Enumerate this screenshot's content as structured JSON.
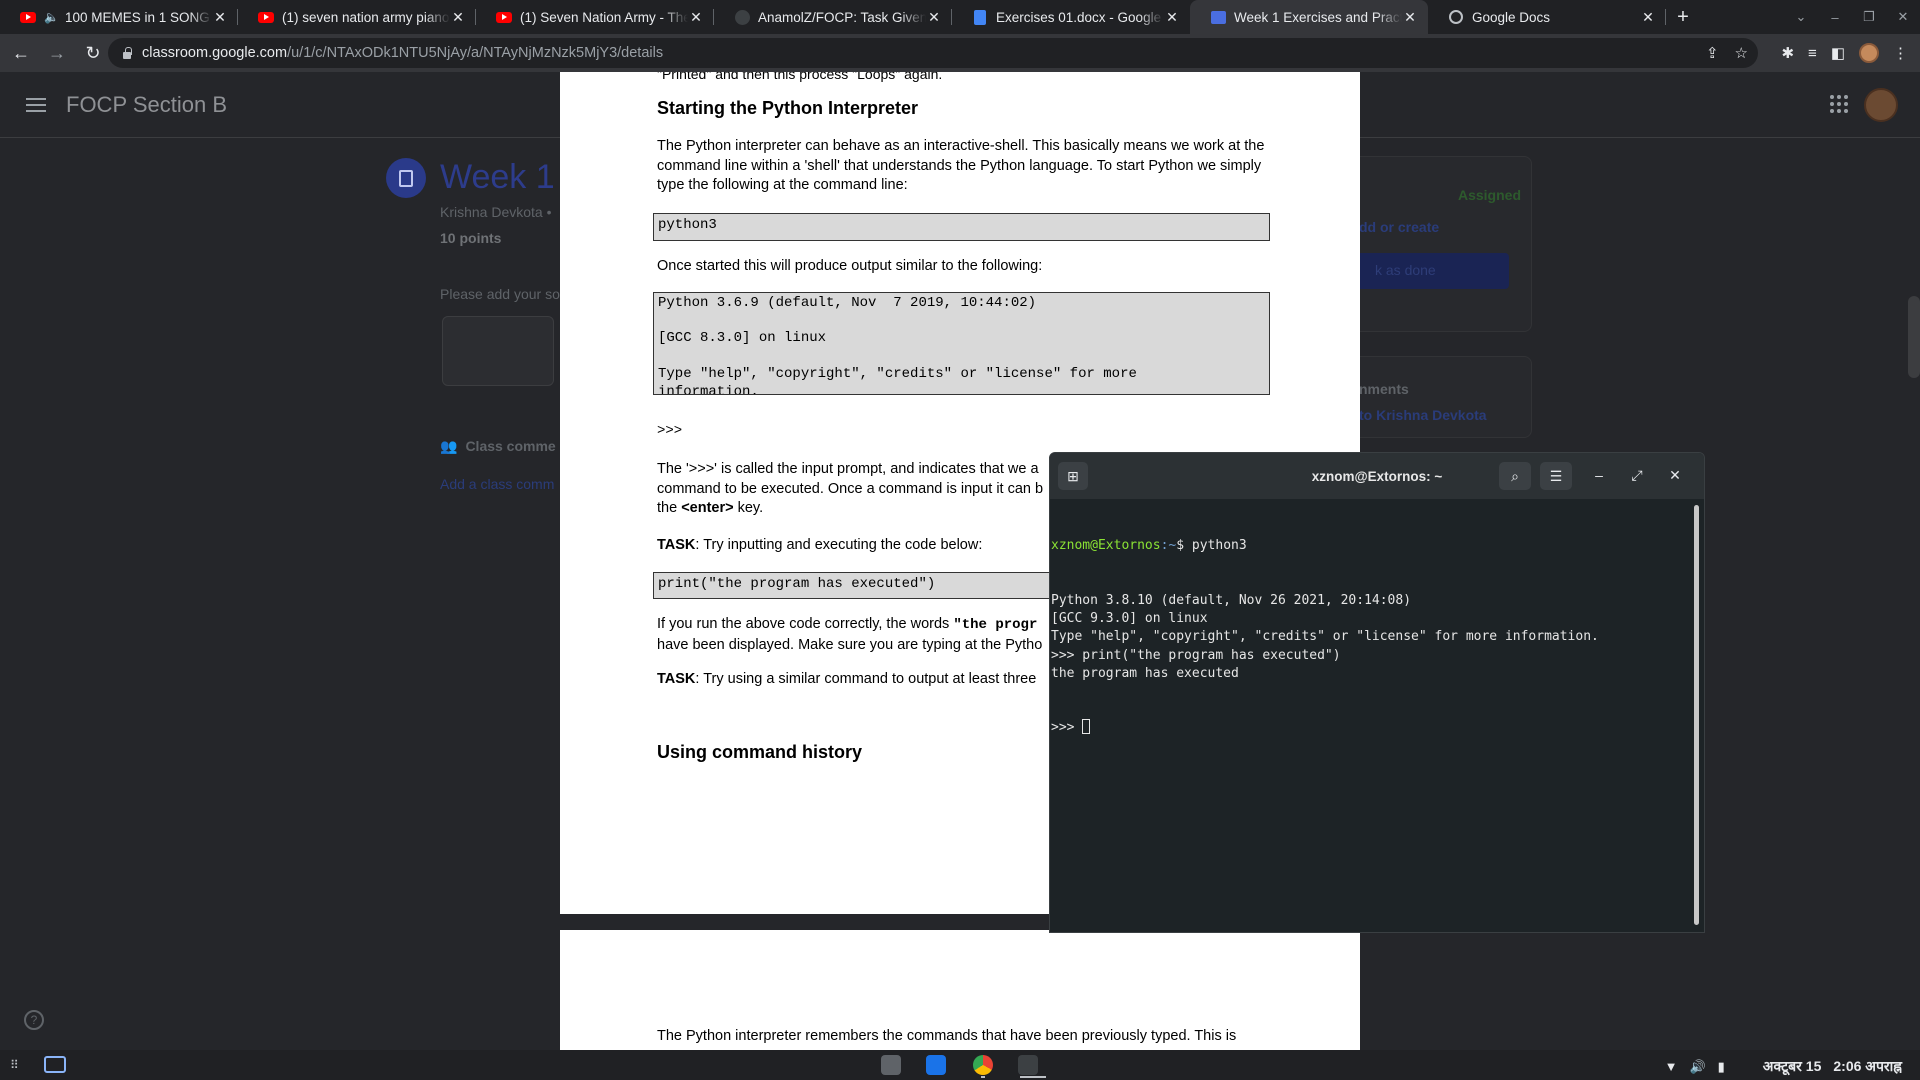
{
  "browser": {
    "tabs": [
      {
        "title": "100 MEMES in 1 SONG (",
        "icon": "youtube-icon",
        "muted": true,
        "active": false
      },
      {
        "title": "(1) seven nation army piano",
        "icon": "youtube-icon",
        "muted": false,
        "active": false
      },
      {
        "title": "(1) Seven Nation Army - The",
        "icon": "youtube-icon",
        "muted": false,
        "active": false
      },
      {
        "title": "AnamolZ/FOCP: Task Given",
        "icon": "github-icon",
        "muted": false,
        "active": false
      },
      {
        "title": "Exercises 01.docx - Google",
        "icon": "docs-icon",
        "muted": false,
        "active": false
      },
      {
        "title": "Week 1 Exercises and Pract",
        "icon": "classroom-icon",
        "muted": false,
        "active": true
      },
      {
        "title": "Google Docs",
        "icon": "globe-icon",
        "muted": false,
        "active": false
      }
    ],
    "url_host": "classroom.google.com",
    "url_path": "/u/1/c/NTAxODk1NTU5NjAy/a/NTAyNjMzNzk5MjY3/details"
  },
  "classroom": {
    "course_title": "FOCP Section B",
    "assignment_title": "Week 1 E",
    "author": "Krishna Devkota •",
    "points": "10 points",
    "description": "Please add your so",
    "class_comments": "Class comme",
    "add_class_comment": "Add a class comm",
    "status": "Assigned",
    "add_or_create": "dd or create",
    "mark_done": "k as done",
    "private_comments": "nments",
    "private_comment_to": "to Krishna Devkota"
  },
  "doc": {
    "cut_line": "\"Printed\" and then this process \"Loops\" again.",
    "heading_interpreter": "Starting the Python Interpreter",
    "para1": "The Python interpreter can behave as an interactive-shell. This basically means we work at the command line within a 'shell' that understands the Python language. To start Python we simply type the following at the command line:",
    "code1": "python3",
    "para2": "Once started this will produce output similar to the following:",
    "code2_lines": [
      "Python 3.6.9 (default, Nov  7 2019, 10:44:02)",
      "",
      "[GCC 8.3.0] on linux",
      "",
      "Type \"help\", \"copyright\", \"credits\" or \"license\" for more",
      "information."
    ],
    "prompt_line": ">>>",
    "para3_lines": [
      "The '>>>' is called the input prompt, and indicates that we a",
      "command to be executed.  Once a command is input it can b"
    ],
    "para3_enter_pre": "the ",
    "para3_enter_key": "<enter>",
    "para3_enter_post": " key.",
    "task_label": "TASK",
    "task1": ": Try inputting and executing the code below:",
    "code3": "print(\"the program has executed\")",
    "para4_pre": "If you run the above code correctly, the words ",
    "para4_bold": "\"the progr",
    "para4_line2": "have been displayed. Make sure you are typing at the Pytho",
    "task2": ": Try using a similar command to output at least three",
    "heading_history": "Using command  history",
    "page2_para": "The Python interpreter remembers the commands that have been previously typed. This is"
  },
  "terminal": {
    "title": "xznom@Extornos: ~",
    "prompt_user": "xznom@Extornos",
    "prompt_path": ":~",
    "prompt_symbol": "$ ",
    "command": "python3",
    "output_lines": [
      "Python 3.8.10 (default, Nov 26 2021, 20:14:08)",
      "[GCC 9.3.0] on linux",
      "Type \"help\", \"copyright\", \"credits\" or \"license\" for more information.",
      ">>> print(\"the program has executed\")",
      "the program has executed"
    ],
    "current_prompt": ">>> "
  },
  "taskbar": {
    "date": "अक्टूबर 15",
    "time": "2:06 अपराह्न"
  }
}
